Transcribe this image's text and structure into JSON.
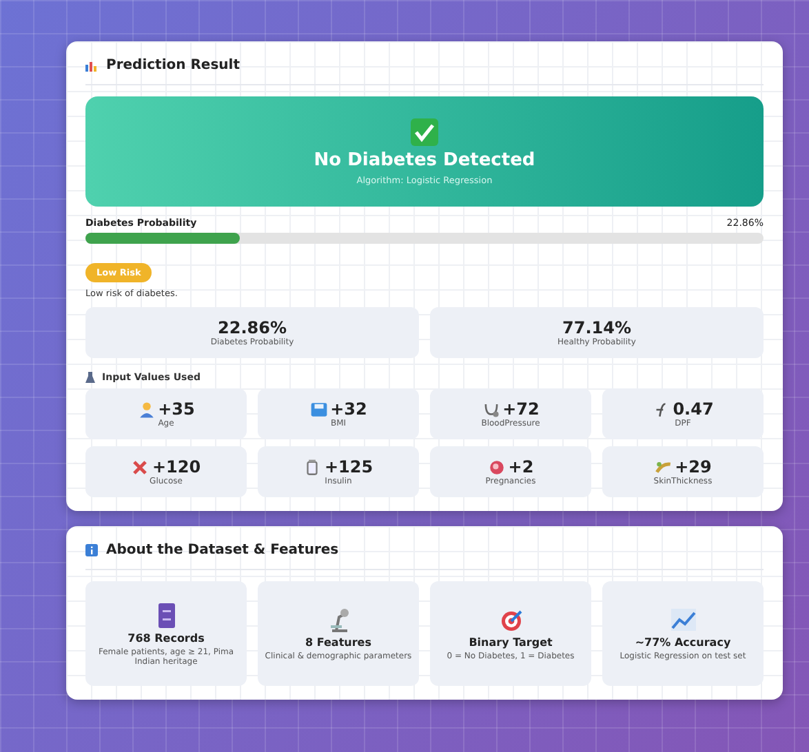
{
  "prediction": {
    "title": "Prediction Result",
    "result": {
      "headline": "No Diabetes Detected",
      "subtitle": "Algorithm: Logistic Regression"
    },
    "probability": {
      "label": "Diabetes Probability",
      "reading": "22.86%",
      "level": 0.2286
    },
    "risk": {
      "badge": "Low Risk",
      "note": "Low risk of diabetes."
    },
    "stats": [
      {
        "value": "22.86%",
        "label": "Diabetes Probability"
      },
      {
        "value": "77.14%",
        "label": "Healthy Probability"
      }
    ],
    "inputs_title": "Input Values Used",
    "inputs": [
      {
        "value": "+35",
        "label": "Age"
      },
      {
        "value": "+32",
        "label": "BMI"
      },
      {
        "value": "+72",
        "label": "BloodPressure"
      },
      {
        "value": "0.47",
        "label": "DPF"
      },
      {
        "value": "+120",
        "label": "Glucose"
      },
      {
        "value": "+125",
        "label": "Insulin"
      },
      {
        "value": "+2",
        "label": "Pregnancies"
      },
      {
        "value": "+29",
        "label": "SkinThickness"
      }
    ]
  },
  "about": {
    "title": "About the Dataset & Features",
    "items": [
      {
        "title": "768 Records",
        "text": "Female patients, age ≥ 21, Pima Indian heritage"
      },
      {
        "title": "8 Features",
        "text": "Clinical & demographic parameters"
      },
      {
        "title": "Binary Target",
        "text": "0 = No Diabetes, 1 = Diabetes"
      },
      {
        "title": "~77% Accuracy",
        "text": "Logistic Regression on test set"
      }
    ]
  }
}
